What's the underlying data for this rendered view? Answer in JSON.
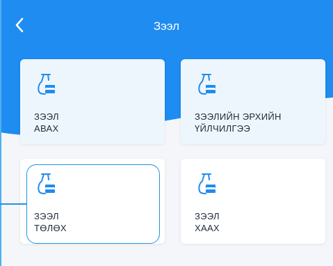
{
  "header": {
    "title": "Зээл",
    "back_icon": "chevron-left-icon"
  },
  "colors": {
    "accent": "#1E8CF0",
    "card_bg": "#FFFFFF",
    "text": "#1F2A38"
  },
  "cards": [
    {
      "line1": "ЗЭЭЛ",
      "line2": "АВАХ",
      "icon": "loan-icon"
    },
    {
      "line1": "ЗЭЭЛИЙН ЭРХИЙН",
      "line2": "ҮЙЛЧИЛГЭЭ",
      "icon": "loan-icon"
    },
    {
      "line1": "ЗЭЭЛ",
      "line2": "ТӨЛӨХ",
      "icon": "loan-icon"
    },
    {
      "line1": "ЗЭЭЛ",
      "line2": "ХААХ",
      "icon": "loan-icon"
    }
  ]
}
